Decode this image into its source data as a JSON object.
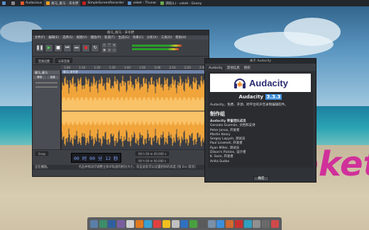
{
  "taskbar": {
    "items": [
      {
        "label": "Audacious",
        "color": "#e05a2a"
      },
      {
        "label": "雁马_雁马 - 宋冬野",
        "color": "#f0a020",
        "active": true
      },
      {
        "label": "SimpleScreenRecorder",
        "color": "#c02020"
      },
      {
        "label": "veket - Thunar",
        "color": "#5a8fc8"
      },
      {
        "label": "调低(L) - veket - Geany",
        "color": "#6aa84f"
      }
    ]
  },
  "audacity": {
    "title": "雁马_雁马 - 宋冬野",
    "menu": [
      "文件(F)",
      "编辑(E)",
      "选择(S)",
      "视图(V)",
      "播放(P)",
      "轨道(T)",
      "生成(G)",
      "效果(C)",
      "分析(A)",
      "工具(O)",
      "帮助(H)"
    ],
    "audio_setup_label": "音频设置",
    "share_label": "分享音频",
    "ruler": [
      "1:00",
      "1:10",
      "1:20",
      "1:30",
      "1:40",
      "1:50",
      "2:00",
      "2:10",
      "2:20",
      "2:30"
    ],
    "track_name": "雁马_雁马",
    "clip_name": "雁马_宋冬野",
    "track_buttons": [
      "静音",
      "独奏"
    ],
    "snap_label": "Snap",
    "time_display": "00 时 00 分 12 秒",
    "selection_start": "00 h 00 m 00.000 s",
    "selection_end": "00 h 00 m 00.000 s",
    "status_left": "正在播放。",
    "status_hint": "点击并拖动可调整立体声轨道的相对大小，双击此处可以设置相同的高度 [按 Esc 取消]"
  },
  "about": {
    "title": "关于 Audacity",
    "tabs": [
      "Audacity",
      "其他信息",
      "授权"
    ],
    "logo_text": "Audacity",
    "version_prefix": "Audacity",
    "version": "3.3.3",
    "description": "Audacity，免费、开源、跨平台的声音录制编辑软件。",
    "heading": "制作组",
    "team_title": "Audacity 荣誉团队成员",
    "team": [
      "Gonzalo Guzmán, 文档和支持",
      "Peter Jonas, 开发者",
      "Martin Keary",
      "Sergey Lapysh, 测试员",
      "Paul Licameli, 开发者",
      "Ryan Miller, 测试员",
      "Dilson's Pickles, 设计者",
      "K. Soze, 开发者",
      "Anita Sudan"
    ],
    "ok_label": "确定"
  },
  "wallpaper_text": "veket",
  "dock_colors": [
    "#5a7fa8",
    "#3c8d6a",
    "#2f5f9f",
    "#7a5fa0",
    "#d0d0d0",
    "#e07a20",
    "#3aa0d0",
    "#e04040",
    "#f0c020",
    "#c0c0c0",
    "#3070c0",
    "#4aa040",
    "#5a5a5a",
    "#7a8fa8",
    "#3c8fdc",
    "#d06a30",
    "#c83030",
    "#30a0c0",
    "#909090",
    "#6a6a6a",
    "#d04a4a"
  ]
}
